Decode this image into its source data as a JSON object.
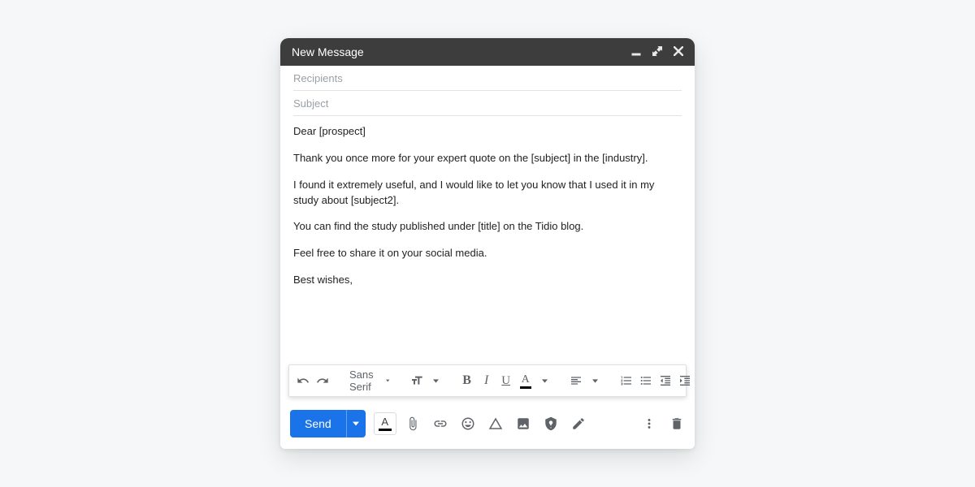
{
  "window": {
    "title": "New Message"
  },
  "fields": {
    "recipients_placeholder": "Recipients",
    "subject_placeholder": "Subject"
  },
  "body": {
    "p1": "Dear [prospect]",
    "p2": "Thank you once more for your expert quote on the [subject] in the [industry].",
    "p3": "I found it extremely useful, and I would like to let you know that I used it in my study about [subject2].",
    "p4": "You can find the study published under [title] on the Tidio blog.",
    "p5": "Feel free to share it on your social media.",
    "p6": "Best wishes,"
  },
  "format": {
    "font_family": "Sans Serif"
  },
  "actions": {
    "send_label": "Send"
  }
}
